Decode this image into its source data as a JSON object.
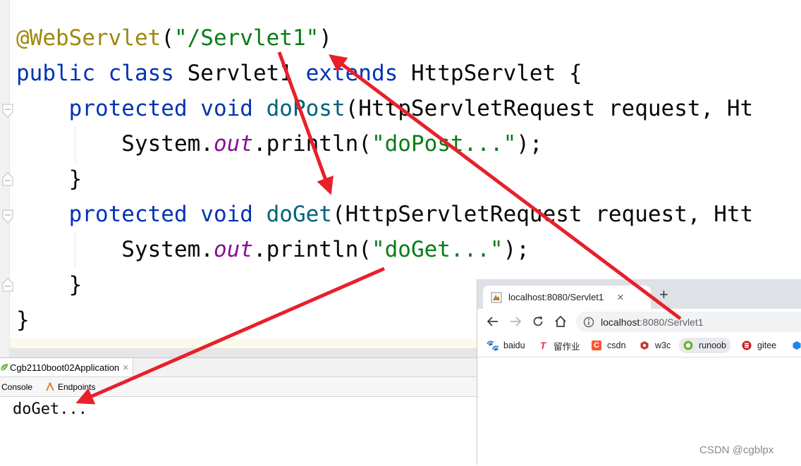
{
  "editor": {
    "lines": [
      {
        "parts": [
          {
            "t": "@WebServlet",
            "c": "ann"
          },
          {
            "t": "(",
            "c": ""
          },
          {
            "t": "\"/Servlet1\"",
            "c": "str"
          },
          {
            "t": ")",
            "c": ""
          }
        ]
      },
      {
        "parts": [
          {
            "t": "public class ",
            "c": "kw"
          },
          {
            "t": "Servlet1 ",
            "c": ""
          },
          {
            "t": "extends ",
            "c": "kw"
          },
          {
            "t": "HttpServlet {",
            "c": ""
          }
        ]
      },
      {
        "parts": [
          {
            "t": "    ",
            "c": ""
          },
          {
            "t": "protected void ",
            "c": "kw"
          },
          {
            "t": "doPost",
            "c": "mth"
          },
          {
            "t": "(HttpServletRequest request, Ht",
            "c": ""
          }
        ]
      },
      {
        "parts": [
          {
            "t": "        System.",
            "c": ""
          },
          {
            "t": "out",
            "c": "fld"
          },
          {
            "t": ".println(",
            "c": ""
          },
          {
            "t": "\"doPost...\"",
            "c": "str"
          },
          {
            "t": ");",
            "c": ""
          }
        ]
      },
      {
        "parts": [
          {
            "t": "    }",
            "c": ""
          }
        ]
      },
      {
        "parts": [
          {
            "t": "    ",
            "c": ""
          },
          {
            "t": "protected void ",
            "c": "kw"
          },
          {
            "t": "doGet",
            "c": "mth"
          },
          {
            "t": "(HttpServletRequest request, Htt",
            "c": ""
          }
        ]
      },
      {
        "parts": [
          {
            "t": "        System.",
            "c": ""
          },
          {
            "t": "out",
            "c": "fld"
          },
          {
            "t": ".println(",
            "c": ""
          },
          {
            "t": "\"doGet...\"",
            "c": "str"
          },
          {
            "t": ");",
            "c": ""
          }
        ]
      },
      {
        "parts": [
          {
            "t": "    }",
            "c": ""
          }
        ]
      },
      {
        "parts": [
          {
            "t": "}",
            "c": ""
          }
        ]
      }
    ]
  },
  "run_panel": {
    "config_tab": "Cgb2110boot02Application",
    "close_glyph": "×",
    "console_tab": "Console",
    "endpoints_tab": "Endpoints",
    "output": "doGet..."
  },
  "browser": {
    "tab_title": "localhost:8080/Servlet1",
    "tab_close": "×",
    "new_tab": "+",
    "url_host": "localhost",
    "url_rest": ":8080/Servlet1",
    "bookmarks": [
      {
        "label": "baidu",
        "icon": "baidu-icon",
        "color": "#2932e1"
      },
      {
        "label": "留作业",
        "icon": "tower-icon",
        "color": "#e6344a"
      },
      {
        "label": "csdn",
        "icon": "csdn-icon",
        "color": "#fc5531"
      },
      {
        "label": "w3c",
        "icon": "w3c-icon",
        "color": "#c0392b"
      },
      {
        "label": "runoob",
        "icon": "runoob-icon",
        "color": "#6cb22e"
      },
      {
        "label": "gitee",
        "icon": "gitee-icon",
        "color": "#c71d23"
      }
    ]
  },
  "watermark": "CSDN @cgblpx",
  "colors": {
    "annotation_arrows": "#e8202a",
    "keyword": "#0033b3",
    "string": "#067d17",
    "method": "#00627a",
    "field": "#871094",
    "annotation": "#9e880d"
  }
}
